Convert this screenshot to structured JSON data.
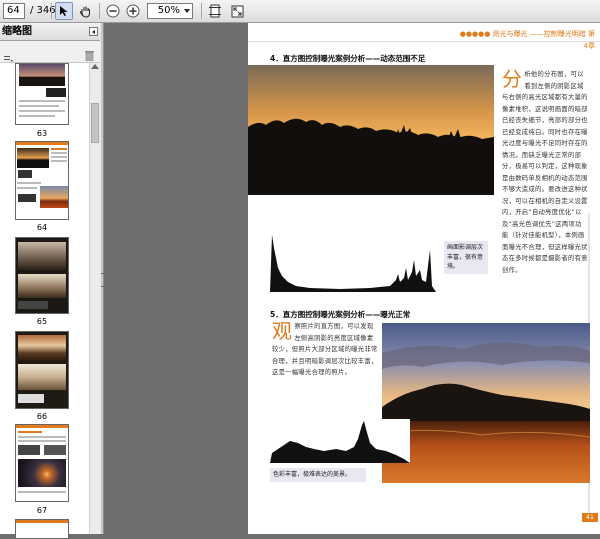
{
  "toolbar": {
    "page_current": "64",
    "page_total": "/ 346",
    "zoom": "50%"
  },
  "sidebar": {
    "title": "缩略图",
    "thumbs": [
      {
        "label": "63"
      },
      {
        "label": "64"
      },
      {
        "label": "65"
      },
      {
        "label": "66"
      },
      {
        "label": "67"
      }
    ]
  },
  "page": {
    "header": "●●●●● 测光与曝光 ——控制曝光明暗  第4章",
    "section4_title": "4．直方图控制曝光案例分析——动态范围不足",
    "section4_dropcap": "分",
    "section4_text": "析他的分布图，可以看到左侧的阴影区域与右侧的高光区域都有大量的像素堆积，这说明画面的暗部已经丧失细节，亮部的部分也已经变成纯白。同时也存在曝光过度与曝光不足同时存在的情况。而缺乏曝光正常的部分，极易可以判定，这种现象是由数码单反相机的动态范围不够大造成的。要改进这种状况，可以在相机的自定义设置内，开启“自动亮度优化”以及“高光色调优先”这两项功能（针对佳能机型），本例画面曝光不合理，但这样曝光状态在多时候都是摄影者的有意创作。",
    "section4_caption": "画面影调层次丰富，很有意境。",
    "section5_title": "5．直方图控制曝光案例分析——曝光正常",
    "section5_dropcap": "观",
    "section5_text": "察照片的直方图，可以发现左侧高阴影的亮度区域像素较少，但照片大部分区域的曝光非常合理，并且明暗影调层次比较丰富，这是一幅曝光合理的照片。",
    "section5_caption": "色彩丰富，极难表达的美景。",
    "page_number": "41"
  },
  "colors": {
    "accent": "#e07a1a",
    "workspace": "#6f6f6f"
  }
}
